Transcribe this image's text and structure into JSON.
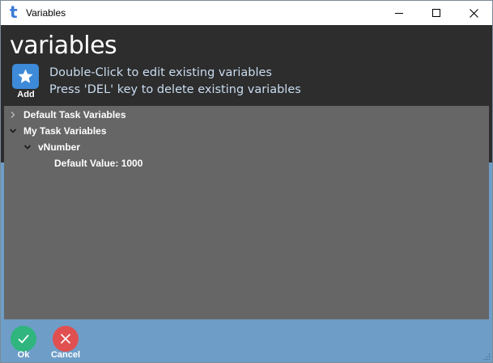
{
  "window": {
    "title": "Variables",
    "app_icon_glyph": "t",
    "controls": {
      "minimize": "minimize-icon",
      "maximize": "maximize-icon",
      "close": "close-icon"
    }
  },
  "header": {
    "title": "variables",
    "add_label": "Add",
    "instructions": [
      "Double-Click to edit existing variables",
      "Press 'DEL' key to delete existing variables"
    ]
  },
  "tree": {
    "items": [
      {
        "label": "Default Task Variables",
        "expanded": false
      },
      {
        "label": "My Task Variables",
        "expanded": true
      },
      {
        "label": "vNumber",
        "expanded": true
      },
      {
        "label": "Default Value: 1000"
      }
    ]
  },
  "actions": {
    "ok_label": "Ok",
    "cancel_label": "Cancel"
  },
  "colors": {
    "header_bg": "#2d2d2d",
    "tree_bg": "#666666",
    "footer_bg": "#6e9ec8",
    "add_icon": "#3d8ad8",
    "ok": "#2fb57d",
    "cancel": "#e05050",
    "instruction_text": "#c9dcf0"
  }
}
